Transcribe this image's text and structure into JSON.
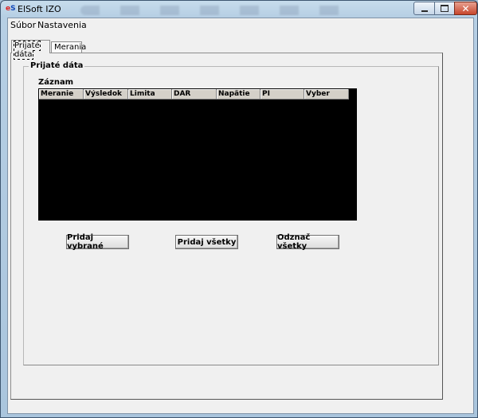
{
  "window": {
    "title": "ElSoft IZO",
    "icon": "app-icon"
  },
  "menu": {
    "items": [
      {
        "label": "Súbor"
      },
      {
        "label": "Nastavenia"
      }
    ]
  },
  "tabs": [
    {
      "label": "Prijaté dáta",
      "active": true
    },
    {
      "label": "Merania",
      "active": false
    }
  ],
  "received": {
    "group_title": "Prijaté dáta",
    "list_label": "Záznam",
    "columns": [
      "Meranie",
      "Výsledok",
      "Limita",
      "DAR",
      "Napätie",
      "PI",
      "Vyber"
    ],
    "rows": []
  },
  "buttons": {
    "add_selected": "Pridaj vybrané",
    "add_all": "Pridaj všetky",
    "uncheck_all": "Odznač všetky"
  },
  "colors": {
    "grid_background": "#000000",
    "header_background": "#d4d0c8",
    "close_button": "#c7462c"
  }
}
